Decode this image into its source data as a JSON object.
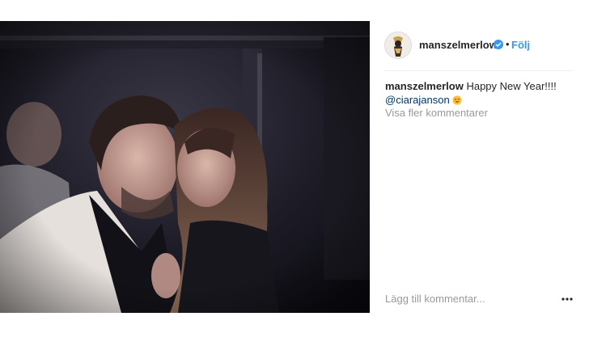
{
  "header": {
    "username": "manszelmerlow",
    "separator": "•",
    "follow_label": "Följ"
  },
  "caption": {
    "username": "manszelmerlow",
    "text": "Happy New Year!!!!",
    "mention": "@ciarajanson",
    "emoji": "heart-eyes-emoji"
  },
  "comments": {
    "view_more_label": "Visa fler kommentarer"
  },
  "comment_box": {
    "placeholder": "Lägg till kommentar..."
  },
  "colors": {
    "link_blue": "#3897f0",
    "mention": "#003569",
    "muted": "#999999",
    "verified": "#3897f0"
  },
  "icons": {
    "verified": "verified-badge-icon",
    "more_options": "more-options-icon"
  }
}
